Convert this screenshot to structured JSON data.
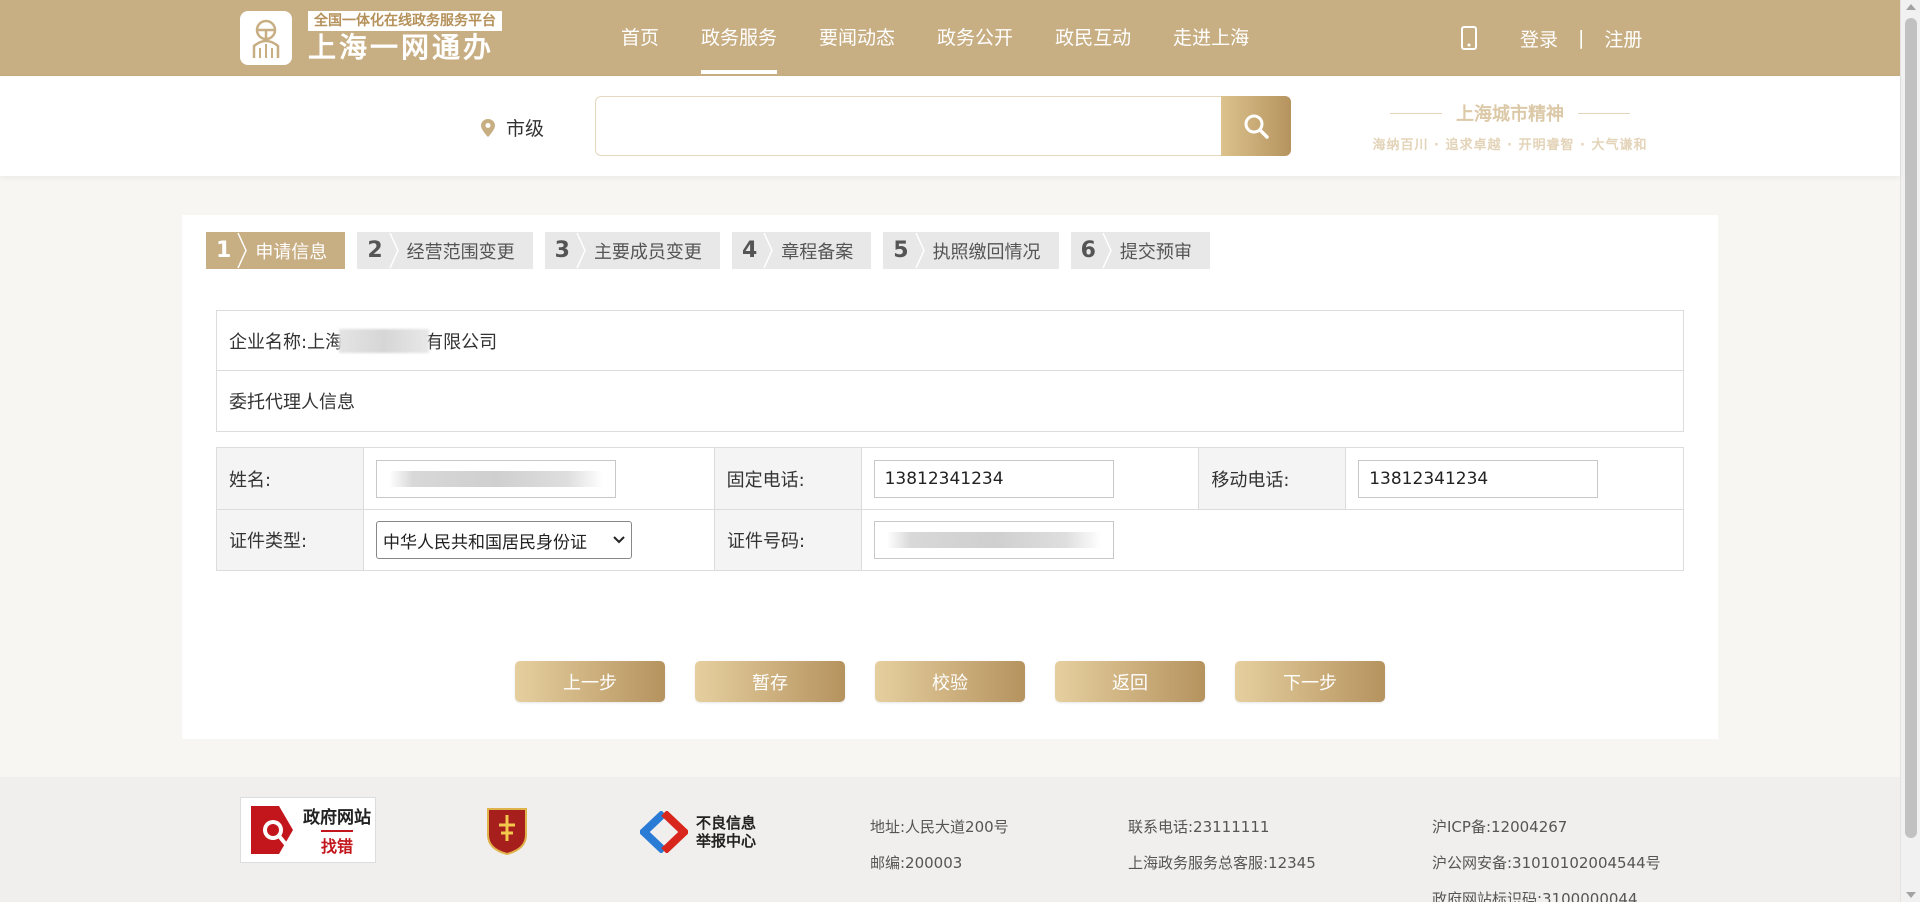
{
  "header": {
    "platform_tag": "全国一体化在线政务服务平台",
    "brand": "上海一网通办",
    "nav": [
      "首页",
      "政务服务",
      "要闻动态",
      "政务公开",
      "政民互动",
      "走进上海"
    ],
    "active_nav": "政务服务",
    "login": "登录",
    "separator": "|",
    "register": "注册",
    "brand_color": "#c8ae83"
  },
  "search": {
    "location": "市级",
    "placeholder": "",
    "spirit_title": "上海城市精神",
    "spirit_motto": "海纳百川 · 追求卓越 · 开明睿智 · 大气谦和"
  },
  "steps": [
    {
      "num": "1",
      "label": "申请信息",
      "active": true
    },
    {
      "num": "2",
      "label": "经营范围变更"
    },
    {
      "num": "3",
      "label": "主要成员变更"
    },
    {
      "num": "4",
      "label": "章程备案"
    },
    {
      "num": "5",
      "label": "执照缴回情况"
    },
    {
      "num": "6",
      "label": "提交预审"
    }
  ],
  "company": {
    "label": "企业名称:",
    "prefix": "上海",
    "suffix": "有限公司"
  },
  "agent_section": "委托代理人信息",
  "form": {
    "name_label": "姓名:",
    "name_value": "",
    "landline_label": "固定电话:",
    "landline_value": "13812341234",
    "mobile_label": "移动电话:",
    "mobile_value": "13812341234",
    "id_type_label": "证件类型:",
    "id_type_value": "中华人民共和国居民身份证",
    "id_number_label": "证件号码:",
    "id_number_value": ""
  },
  "buttons": [
    "上一步",
    "暂存",
    "校验",
    "返回",
    "下一步"
  ],
  "footer": {
    "gov_site": "政府网站",
    "gov_site_error": "找错",
    "report_center_1": "不良信息",
    "report_center_2": "举报中心",
    "address": "地址:人民大道200号",
    "postcode": "邮编:200003",
    "phone": "联系电话:23111111",
    "hotline": "上海政务服务总客服:12345",
    "icp": "沪ICP备:12004267",
    "police": "沪公网安备:31010102004544号",
    "site_id": "政府网站标识码:3100000044"
  }
}
